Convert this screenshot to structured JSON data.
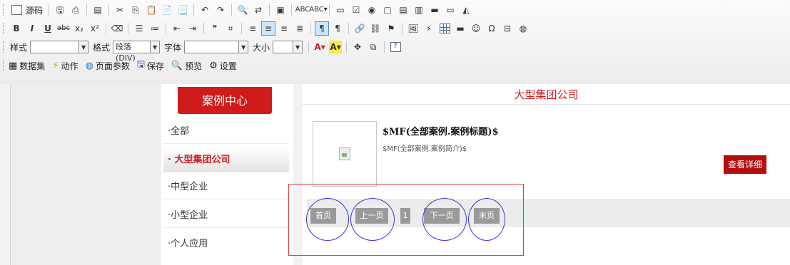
{
  "toolbar": {
    "source_label": "源码",
    "style_label": "样式",
    "format_label": "格式",
    "format_value": "段落(DIV)",
    "font_label": "字体",
    "size_label": "大小",
    "actions": {
      "dataset": "数据集",
      "action": "动作",
      "page_params": "页面参数",
      "save": "保存",
      "preview": "预览",
      "settings": "设置"
    }
  },
  "sidebar": {
    "title": "案例中心",
    "items": [
      {
        "label": "·全部"
      },
      {
        "label": "· 大型集团公司"
      },
      {
        "label": "·中型企业"
      },
      {
        "label": "·小型企业"
      },
      {
        "label": "·个人应用"
      }
    ]
  },
  "main": {
    "title": "大型集团公司",
    "case_title": "$MF(全部案例.案例标题)$",
    "case_intro": "$MF(全部案例.案例简介)$",
    "detail_button": "查看详细"
  },
  "pager": {
    "first": "首页",
    "prev": "上一页",
    "page": "1",
    "next": "下一页",
    "last": "末页"
  },
  "colors": {
    "accent": "#d01b1b",
    "annotation_circle": "#3a3ad8",
    "annotation_box": "#e23b3b"
  }
}
